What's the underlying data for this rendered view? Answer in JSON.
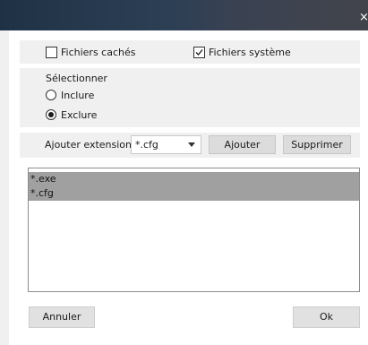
{
  "titlebar": {
    "close_glyph": "×"
  },
  "options": {
    "hidden_files": {
      "label": "Fichiers cachés",
      "checked": false
    },
    "system_files": {
      "label": "Fichiers système",
      "checked": true
    }
  },
  "select_group": {
    "title": "Sélectionner",
    "include": {
      "label": "Inclure",
      "selected": false
    },
    "exclude": {
      "label": "Exclure",
      "selected": true
    }
  },
  "extension": {
    "label": "Ajouter extension",
    "value": "*.cfg",
    "add_label": "Ajouter",
    "remove_label": "Supprimer"
  },
  "list": {
    "items": [
      "*.exe",
      "*.cfg"
    ]
  },
  "footer": {
    "cancel_label": "Annuler",
    "ok_label": "Ok"
  }
}
